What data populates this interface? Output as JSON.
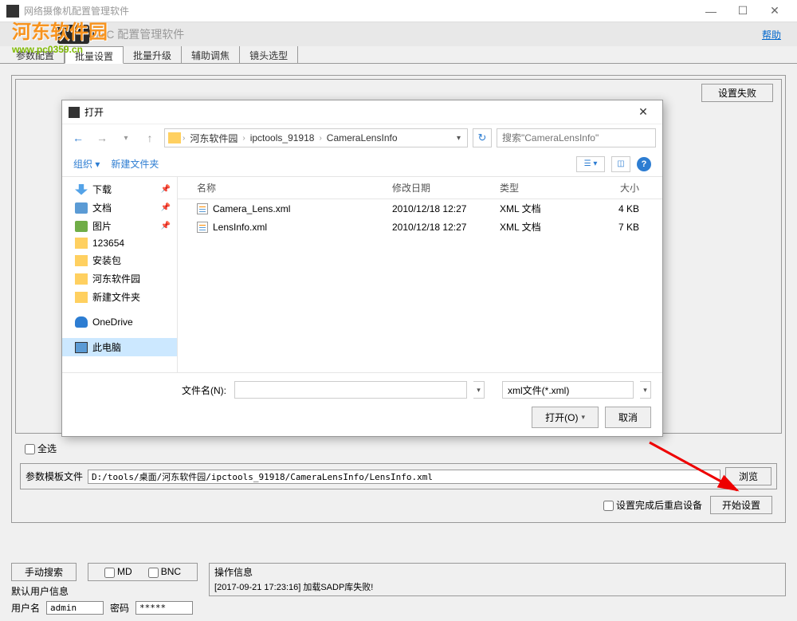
{
  "window": {
    "title": "网络摄像机配置管理软件",
    "minimize": "—",
    "maximize": "☐",
    "close": "✕"
  },
  "watermark": {
    "title": "河东软件园",
    "url": "www.pc0359.cn"
  },
  "header": {
    "app_title": "IPC 配置管理软件",
    "help": "帮助"
  },
  "tabs": [
    "参数配置",
    "批量设置",
    "批量升级",
    "辅助调焦",
    "镜头选型"
  ],
  "content": {
    "setting_fail": "设置失败",
    "select_all": "全选",
    "template_label": "参数模板文件",
    "template_value": "D:/tools/桌面/河东软件园/ipctools_91918/CameraLensInfo/LensInfo.xml",
    "browse": "浏览",
    "restart_label": "设置完成后重启设备",
    "start": "开始设置"
  },
  "footer": {
    "manual_search": "手动搜索",
    "md": "MD",
    "bnc": "BNC",
    "op_info_label": "操作信息",
    "op_info_text": "[2017-09-21 17:23:16] 加载SADP库失败!",
    "default_user_label": "默认用户信息",
    "username_label": "用户名",
    "username_value": "admin",
    "password_label": "密码",
    "password_value": "*****"
  },
  "dialog": {
    "title": "打开",
    "breadcrumbs": [
      "河东软件园",
      "ipctools_91918",
      "CameraLensInfo"
    ],
    "search_placeholder": "搜索\"CameraLensInfo\"",
    "organize": "组织",
    "new_folder": "新建文件夹",
    "columns": {
      "name": "名称",
      "date": "修改日期",
      "type": "类型",
      "size": "大小"
    },
    "sidebar": [
      {
        "icon": "download",
        "label": "下载",
        "pinned": true
      },
      {
        "icon": "doc",
        "label": "文档",
        "pinned": true
      },
      {
        "icon": "pic",
        "label": "图片",
        "pinned": true
      },
      {
        "icon": "folder",
        "label": "123654"
      },
      {
        "icon": "folder",
        "label": "安装包"
      },
      {
        "icon": "folder",
        "label": "河东软件园"
      },
      {
        "icon": "folder",
        "label": "新建文件夹"
      },
      {
        "icon": "cloud",
        "label": "OneDrive",
        "spaced": true
      },
      {
        "icon": "pc",
        "label": "此电脑",
        "selected": true,
        "spaced": true
      }
    ],
    "files": [
      {
        "name": "Camera_Lens.xml",
        "date": "2010/12/18 12:27",
        "type": "XML 文档",
        "size": "4 KB"
      },
      {
        "name": "LensInfo.xml",
        "date": "2010/12/18 12:27",
        "type": "XML 文档",
        "size": "7 KB"
      }
    ],
    "filename_label": "文件名(N):",
    "filetype": "xml文件(*.xml)",
    "open_btn": "打开(O)",
    "cancel_btn": "取消"
  }
}
